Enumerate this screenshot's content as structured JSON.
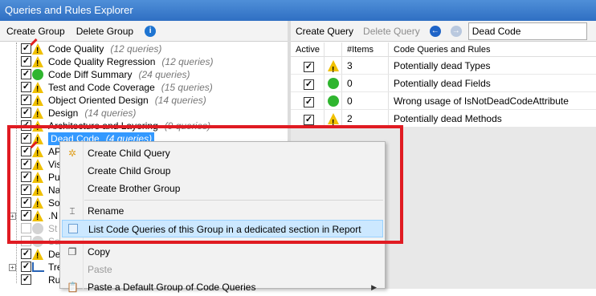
{
  "window": {
    "title": "Queries and Rules Explorer"
  },
  "left_toolbar": {
    "create_group": "Create Group",
    "delete_group": "Delete Group",
    "info_icon": "info-icon"
  },
  "right_toolbar": {
    "create_query": "Create Query",
    "delete_query": "Delete Query",
    "current_group": "Dead Code"
  },
  "tree": {
    "items": [
      {
        "label": "Code Quality",
        "count": "(12 queries)",
        "icon": "warning-icon"
      },
      {
        "label": "Code Quality Regression",
        "count": "(12 queries)",
        "icon": "warning-icon"
      },
      {
        "label": "Code Diff Summary",
        "count": "(24 queries)",
        "icon": "ok-icon"
      },
      {
        "label": "Test and Code Coverage",
        "count": "(15 queries)",
        "icon": "warning-icon"
      },
      {
        "label": "Object Oriented Design",
        "count": "(14 queries)",
        "icon": "warning-icon"
      },
      {
        "label": "Design",
        "count": "(14 queries)",
        "icon": "warning-icon"
      },
      {
        "label": "Architecture and Layering",
        "count": "(9 queries)",
        "icon": "warning-icon"
      },
      {
        "label": "Dead Code",
        "count": "(4 queries)",
        "icon": "warning-icon"
      },
      {
        "label": "API",
        "count": "",
        "icon": "warning-icon"
      },
      {
        "label": "Vis",
        "count": "",
        "icon": "warning-icon"
      },
      {
        "label": "Pu",
        "count": "",
        "icon": "warning-icon"
      },
      {
        "label": "Na",
        "count": "",
        "icon": "warning-icon"
      },
      {
        "label": "So",
        "count": "",
        "icon": "warning-icon"
      },
      {
        "label": ".N",
        "count": "",
        "icon": "warning-icon"
      },
      {
        "label": "St",
        "count": "",
        "icon": "grey-dot-icon"
      },
      {
        "label": "Sa",
        "count": "",
        "icon": "grey-dot-icon"
      },
      {
        "label": "De",
        "count": "",
        "icon": "warning-icon"
      },
      {
        "label": "Tre",
        "count": "",
        "icon": "chart-icon"
      },
      {
        "label": "Ru",
        "count": "",
        "icon": "none"
      }
    ]
  },
  "grid": {
    "headers": [
      "Active",
      "",
      "#Items",
      "Code Queries and Rules"
    ],
    "rows": [
      {
        "active": true,
        "status": "warning-icon",
        "items": "3",
        "name": "Potentially dead Types"
      },
      {
        "active": true,
        "status": "ok-icon",
        "items": "0",
        "name": "Potentially dead Fields"
      },
      {
        "active": true,
        "status": "ok-icon",
        "items": "0",
        "name": "Wrong usage of IsNotDeadCodeAttribute"
      },
      {
        "active": true,
        "status": "warning-icon",
        "items": "2",
        "name": "Potentially dead Methods"
      }
    ]
  },
  "context_menu": {
    "create_child_query": "Create Child Query",
    "create_child_group": "Create Child Group",
    "create_brother_group": "Create Brother Group",
    "rename": "Rename",
    "list_queries": "List Code Queries of this Group in a dedicated section in Report",
    "copy": "Copy",
    "paste": "Paste",
    "paste_default": "Paste a Default Group of Code Queries"
  },
  "colors": {
    "highlight_outline": "#e01b22",
    "selection": "#3399ff",
    "menu_highlight": "#cce8ff"
  }
}
